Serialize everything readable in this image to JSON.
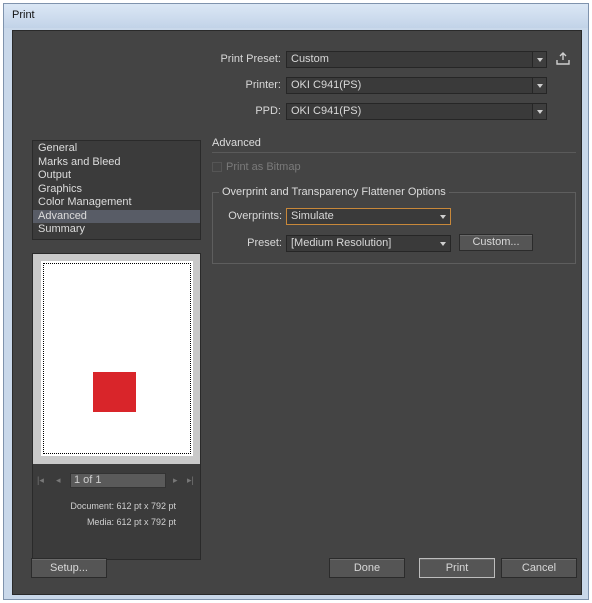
{
  "window": {
    "title": "Print"
  },
  "top": {
    "preset_label": "Print Preset:",
    "preset_value": "Custom",
    "printer_label": "Printer:",
    "printer_value": "OKI C941(PS)",
    "ppd_label": "PPD:",
    "ppd_value": "OKI C941(PS)"
  },
  "sidebar": {
    "items": [
      {
        "label": "General"
      },
      {
        "label": "Marks and Bleed"
      },
      {
        "label": "Output"
      },
      {
        "label": "Graphics"
      },
      {
        "label": "Color Management"
      },
      {
        "label": "Advanced"
      },
      {
        "label": "Summary"
      }
    ],
    "selected": "Advanced"
  },
  "preview": {
    "page_indicator": "1 of 1",
    "document_size": "Document: 612 pt x 792 pt",
    "media_size": "Media: 612 pt x 792 pt",
    "object_color": "#d9252a"
  },
  "advanced": {
    "title": "Advanced",
    "print_as_bitmap_label": "Print as Bitmap",
    "print_as_bitmap_checked": false,
    "group_title": "Overprint and Transparency Flattener Options",
    "overprints_label": "Overprints:",
    "overprints_value": "Simulate",
    "preset_label": "Preset:",
    "preset_value": "[Medium Resolution]",
    "custom_button": "Custom..."
  },
  "buttons": {
    "setup": "Setup...",
    "done": "Done",
    "print": "Print",
    "cancel": "Cancel"
  },
  "colors": {
    "panel_bg": "#444444",
    "selected_item": "#585c66",
    "focus_border": "#c8883a"
  },
  "icons": [
    "save-preset-icon",
    "dropdown-arrow-icon",
    "first-page-icon",
    "previous-page-icon",
    "next-page-icon",
    "last-page-icon"
  ]
}
